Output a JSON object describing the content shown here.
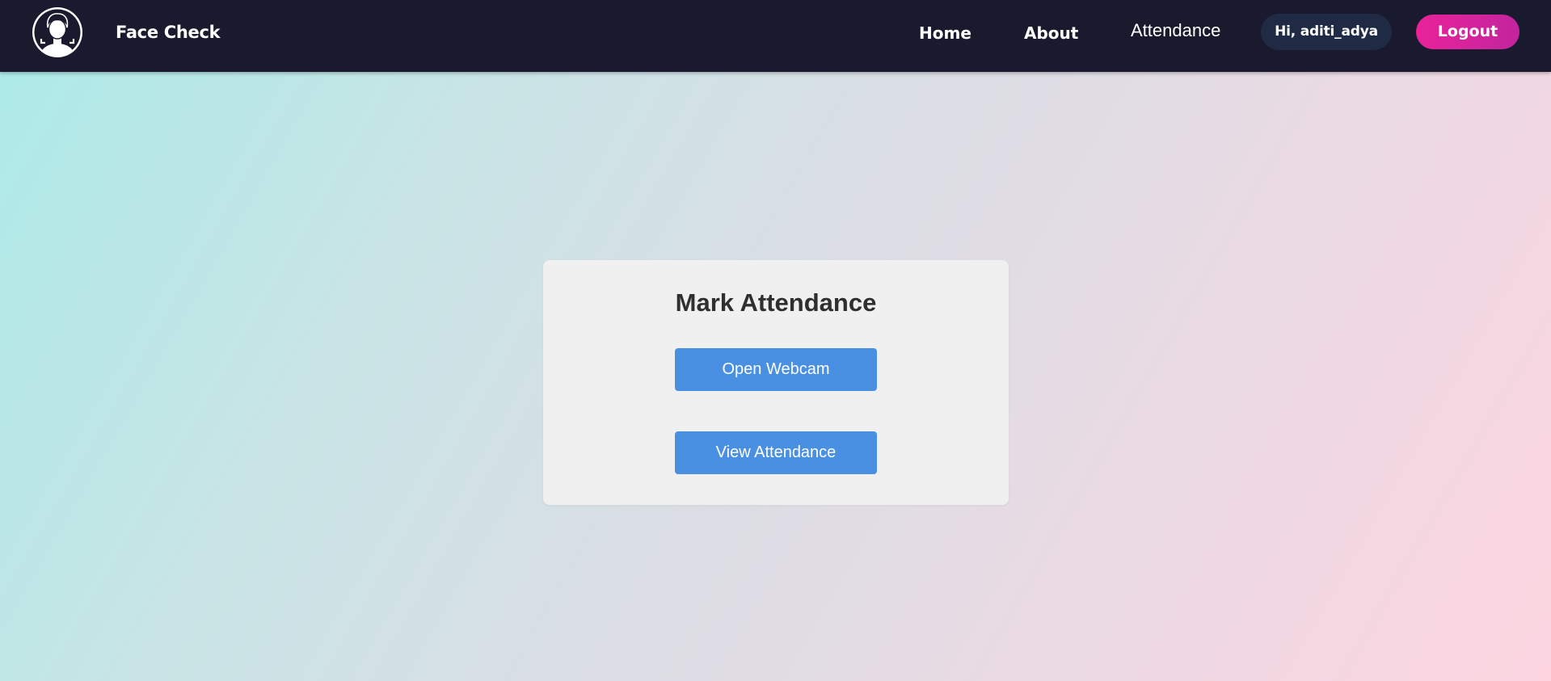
{
  "navbar": {
    "logo_icon": "face-scan-icon",
    "brand": "Face Check",
    "links": {
      "home": "Home",
      "about": "About",
      "attendance": "Attendance"
    },
    "greeting": "Hi, aditi_adya",
    "logout_label": "Logout"
  },
  "card": {
    "title": "Mark Attendance",
    "open_webcam_label": "Open Webcam",
    "view_attendance_label": "View Attendance"
  },
  "colors": {
    "navbar_bg": "#1a1a2e",
    "greeting_bg": "#1f2b44",
    "logout_gradient_start": "#e9239a",
    "logout_gradient_end": "#c2249e",
    "button_blue": "#4a90e2",
    "card_bg": "#f0f0f0",
    "page_gradient_start": "#abebe8",
    "page_gradient_end": "#fcd5e1"
  }
}
